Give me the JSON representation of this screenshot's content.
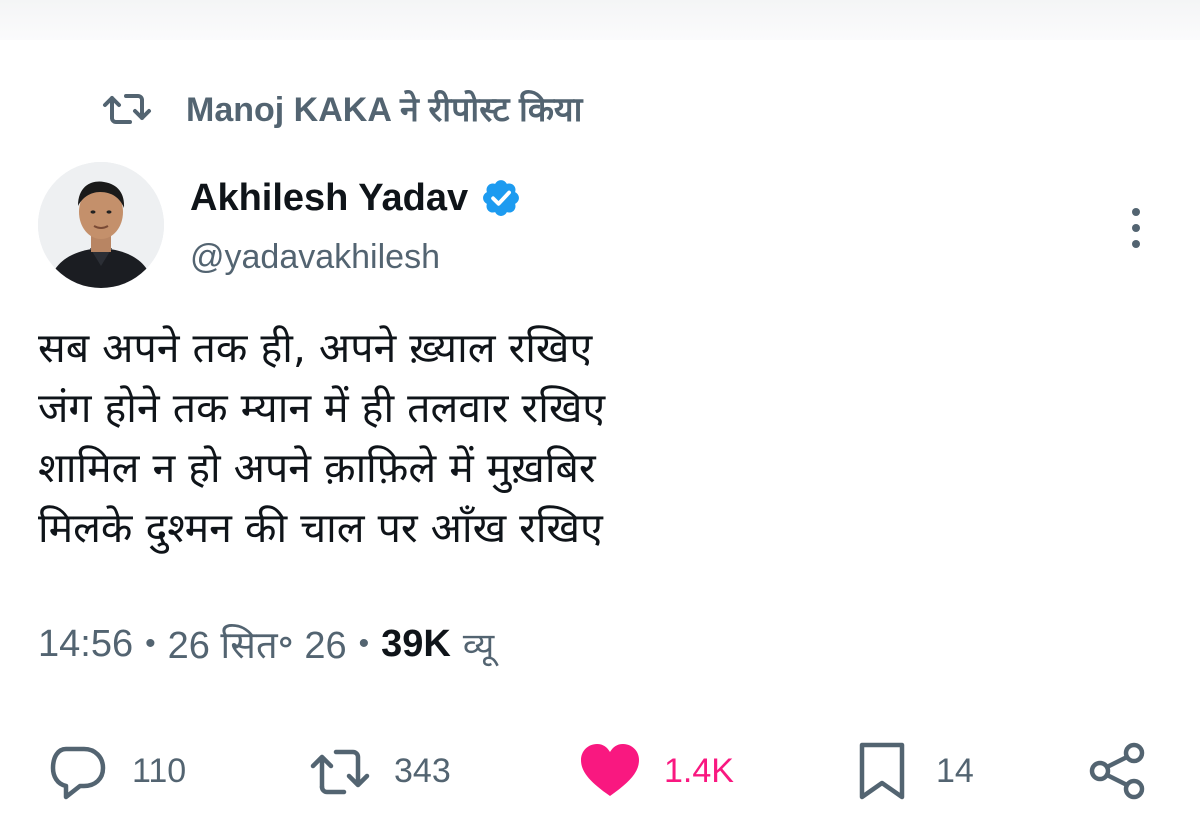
{
  "repost": {
    "text": "Manoj KAKA ने रीपोस्ट किया",
    "icon": "retweet-icon"
  },
  "author": {
    "name": "Akhilesh Yadav",
    "handle": "@yadavakhilesh",
    "verified": true,
    "verified_color": "#1d9bf0"
  },
  "tweet": {
    "lines": [
      "सब अपने तक ही, अपने ख़्याल रखिए",
      "जंग होने तक म्यान में ही तलवार रखिए",
      "शामिल न हो अपने क़ाफ़िले में मुख़बिर",
      "मिलके दुश्मन की चाल पर आँख रखिए"
    ]
  },
  "meta": {
    "time": "14:56",
    "date": "26 सित॰ 26",
    "separator": "•",
    "views_count": "39K",
    "views_label": "व्यू"
  },
  "actions": {
    "replies": "110",
    "reposts": "343",
    "likes": "1.4K",
    "bookmarks": "14"
  },
  "colors": {
    "text_primary": "#0f1419",
    "text_secondary": "#536471",
    "like_pink": "#f91880",
    "verified_blue": "#1d9bf0"
  }
}
